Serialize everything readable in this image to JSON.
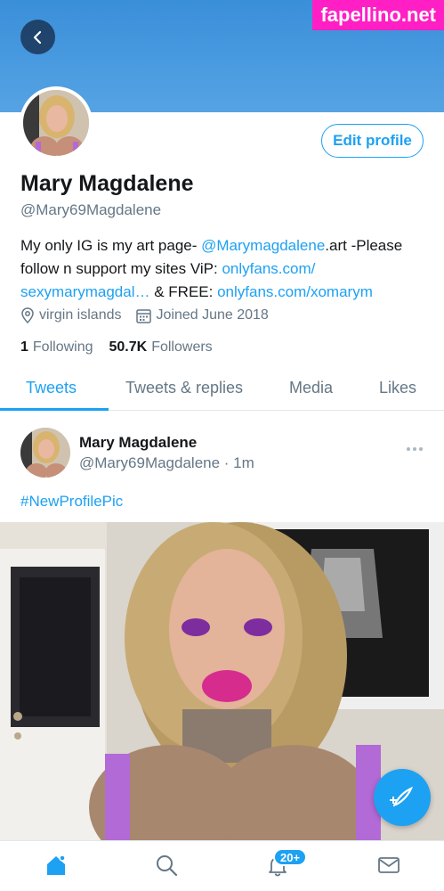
{
  "watermark": "fapellino.net",
  "profile": {
    "display_name": "Mary Magdalene",
    "handle": "@Mary69Magdalene",
    "edit_button": "Edit profile",
    "bio": {
      "part1": "My only IG is my art page- ",
      "link1": "@Marymagdalene",
      "part2": ".art -Please follow n support my sites ViP: ",
      "link2": "onlyfans.com/ sexymarymagdal…",
      "part3": " & FREE: ",
      "link3": "onlyfans.com/xomarym"
    },
    "location": "virgin islands",
    "joined": "Joined June 2018",
    "following_count": "1",
    "following_label": "Following",
    "followers_count": "50.7K",
    "followers_label": "Followers"
  },
  "tabs": [
    {
      "label": "Tweets",
      "active": true
    },
    {
      "label": "Tweets & replies",
      "active": false
    },
    {
      "label": "Media",
      "active": false
    },
    {
      "label": "Likes",
      "active": false
    }
  ],
  "tweet": {
    "name": "Mary Magdalene",
    "handle_time": "@Mary69Magdalene · 1m",
    "text": "#NewProfilePic"
  },
  "bottom_nav": {
    "notifications_badge": "20+",
    "icons": [
      "home-icon",
      "search-icon",
      "bell-icon",
      "mail-icon"
    ]
  },
  "colors": {
    "accent": "#1da1f2",
    "banner": "#4a9be0",
    "secondary_text": "#657786"
  }
}
